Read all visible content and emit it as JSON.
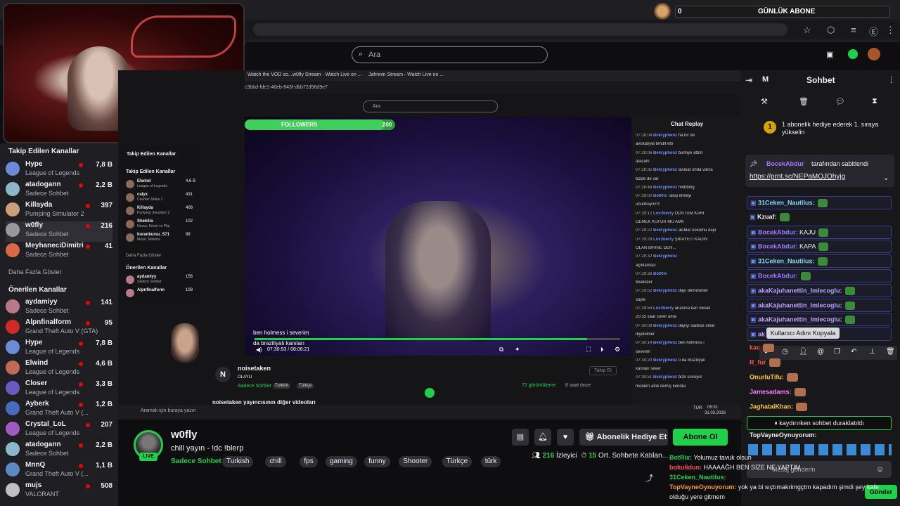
{
  "browser": {
    "tab_numbers": "3"
  },
  "goal": {
    "count": "0",
    "label": "GÜNLÜK ABONE"
  },
  "search": {
    "placeholder": "Ara"
  },
  "sidebar": {
    "followed_title": "Takip Edilen Kanallar",
    "followed": [
      {
        "name": "Hype",
        "game": "League of Legends",
        "count": "7,8 B",
        "color": "#6b8bd6"
      },
      {
        "name": "atadogann",
        "game": "Sadece Sohbet",
        "count": "2,2 B",
        "color": "#8ab8c8"
      },
      {
        "name": "Killayda",
        "game": "Pumping Simulator 2",
        "count": "397",
        "color": "#c9a07a"
      },
      {
        "name": "w0fly",
        "game": "Sadece Sohbet",
        "count": "216",
        "color": "#999999"
      },
      {
        "name": "MeyhaneciDimitri",
        "game": "Sadece Sohbet",
        "count": "41",
        "color": "#d86a4a"
      }
    ],
    "more": "Daha Fazla Göster",
    "recommended_title": "Önerilen Kanallar",
    "recommended": [
      {
        "name": "aydamiyy",
        "game": "Sadece Sohbet",
        "count": "141",
        "color": "#b87a8a"
      },
      {
        "name": "Alpnfinalform",
        "game": "Grand Theft Auto V (GTA)",
        "count": "95",
        "color": "#d12828"
      },
      {
        "name": "Hype",
        "game": "League of Legends",
        "count": "7,8 B",
        "color": "#6b8bd6"
      },
      {
        "name": "Elwind",
        "game": "League of Legends",
        "count": "4,6 B",
        "color": "#c06a5a"
      },
      {
        "name": "Closer",
        "game": "League of Legends",
        "count": "3,3 B",
        "color": "#6a5ac0"
      },
      {
        "name": "Ayberk",
        "game": "Grand Theft Auto V (...",
        "count": "1,2 B",
        "color": "#4a6ac0"
      },
      {
        "name": "Crystal_LoL",
        "game": "League of Legends",
        "count": "207",
        "color": "#a05ac0"
      },
      {
        "name": "atadogann",
        "game": "Sadece Sohbet",
        "count": "2,2 B",
        "color": "#8ab8c8"
      },
      {
        "name": "MnnQ",
        "game": "Grand Theft Auto V (...",
        "count": "1,1 B",
        "color": "#5a8ac0"
      },
      {
        "name": "mujs",
        "game": "VALORANT",
        "count": "508",
        "color": "#c0c0c0"
      }
    ]
  },
  "inner": {
    "tabs": [
      "Watch the VOD so...",
      "w0fly Stream - Watch Live on ...",
      "Jahnnin Stream - Watch Live on ..."
    ],
    "url": "c3bbd-fde1-46eb-843f-dbb72d56d9e7",
    "search": "Ara",
    "followers_label": "FOLLOWERS",
    "followers_count": "200",
    "followers_progress": 0.93,
    "side_title": "Takip Edilen Kanallar",
    "side_section": "Takip Edilen Kanallar",
    "side_items": [
      {
        "name": "Elwind",
        "game": "League of Legends",
        "count": "4,6 B"
      },
      {
        "name": "calyx",
        "game": "Counter-Strike 2",
        "count": "431"
      },
      {
        "name": "Killayda",
        "game": "Pumping Simulator 2",
        "count": "408"
      },
      {
        "name": "Shekilia",
        "game": "Havuz, Küvet ve Plaj",
        "count": "102"
      },
      {
        "name": "kurankursu_571",
        "game": "Music Stations",
        "count": "98"
      }
    ],
    "side_more": "Daha Fazla Göster",
    "side_rec": "Önerilen Kanallar",
    "side_rec_items": [
      {
        "name": "aydamiyy",
        "game": "Sadece Sohbet",
        "count": "156"
      },
      {
        "name": "Alpnfinalform",
        "game": "",
        "count": "108"
      }
    ],
    "caption1": "ben holmess i severim",
    "caption2": "da braziliyalı kanıları",
    "time": "07:30:53 / 08:06:21",
    "chat_title": "Chat Replay",
    "chat": [
      {
        "t": "07:28:04",
        "u": "Bekryphenz",
        "m": "ha bir de"
      },
      {
        "t": "",
        "u": "",
        "m": "avukatıyla tehdit etti"
      },
      {
        "t": "07:28:06",
        "u": "Bekryphenz",
        "m": "burhiye attım"
      },
      {
        "t": "",
        "u": "",
        "m": "atacam"
      },
      {
        "t": "07:28:35",
        "u": "Bekryphenz",
        "m": "avukat onda varsa"
      },
      {
        "t": "",
        "u": "",
        "m": "bizde de var"
      },
      {
        "t": "07:28:46",
        "u": "Bekryphenz",
        "m": "mobbing"
      },
      {
        "t": "07:29:00",
        "u": "BotRix",
        "m": "Takip etmeyi"
      },
      {
        "t": "",
        "u": "",
        "m": "unutmayın!!!!"
      },
      {
        "t": "07:29:12",
        "u": "Lov3berry",
        "m": "DOSTUM KARI"
      },
      {
        "t": "",
        "u": "",
        "m": "DEMEK KÜFÜR MÜ AMK"
      },
      {
        "t": "07:29:22",
        "u": "Bekryphenz",
        "m": "akıldar kokumu dayı"
      },
      {
        "t": "07:29:28",
        "u": "Lov3berry",
        "m": "ŞİKAYETİ KADIN"
      },
      {
        "t": "",
        "u": "",
        "m": "OLAN BİRİNE DEN..."
      },
      {
        "t": "07:29:32",
        "u": "Bekryphenz",
        "m": ""
      },
      {
        "t": "",
        "u": "",
        "m": "açıklaması"
      },
      {
        "t": "07:29:36",
        "u": "BotRix",
        "m": ""
      },
      {
        "t": "",
        "u": "",
        "m": "biseksler"
      },
      {
        "t": "07:29:52",
        "u": "Bekryphenz",
        "m": "dayı demesinler"
      },
      {
        "t": "",
        "u": "",
        "m": "söyle"
      },
      {
        "t": "07:29:54",
        "u": "Lov3berry",
        "m": "anasına karı desek"
      },
      {
        "t": "",
        "u": "",
        "m": "20:35 saat söver ama"
      },
      {
        "t": "07:30:08",
        "u": "Bekryphenz",
        "m": "dayıyı sadece onlar"
      },
      {
        "t": "",
        "u": "",
        "m": "diyebilirler"
      },
      {
        "t": "07:30:14",
        "u": "Bekryphenz",
        "m": "ben holmess i"
      },
      {
        "t": "",
        "u": "",
        "m": "severim"
      },
      {
        "t": "07:30:20",
        "u": "Bekryphenz",
        "m": "o da braziliyalı"
      },
      {
        "t": "",
        "u": "",
        "m": "kanıları sever"
      },
      {
        "t": "07:30:51",
        "u": "Bekryphenz",
        "m": "bize sövüyor"
      },
      {
        "t": "",
        "u": "",
        "m": "modern amk demiş kendisi"
      }
    ],
    "channel": "noisetaken",
    "channel_cat": "OLAYLI",
    "cat2": "Sadece Sohbet",
    "tag1": "Turkish",
    "tag2": "Türkçe",
    "follow": "Takip Et",
    "views": "72 görüntüleme",
    "ago": "8 saat önce",
    "more_videos": "noisetaken yayıncısının diğer videoları",
    "taskbar_search": "Aramak için buraya yazın",
    "clock": "05:31",
    "date": "31.03.2026",
    "lang": "TUR"
  },
  "stream": {
    "name": "w0fly",
    "title": "chill yayın - !dc !blerp",
    "category": "Sadece Sohbet",
    "tags": [
      "Turkish",
      "chill",
      "fps",
      "gaming",
      "funny",
      "Shooter",
      "Türkçe",
      "türk"
    ],
    "live": "LIVE",
    "gift_label": "Abonelik Hediye Et",
    "sub_label": "Abone Ol",
    "viewers": "216",
    "viewers_label": "İzleyici",
    "chatters": "15",
    "chatters_label": "Ort. Sohbete Katılan..."
  },
  "chat": {
    "header_letter": "M",
    "title": "Sohbet",
    "banner": "1 abonelik hediye ederek 1. sıraya yükselin",
    "banner_num": "1",
    "pinned_by": "BocekAbdur",
    "pinned_suffix": "tarafından sabitlendi",
    "pinned_link": "https://prnt.sc/NEPaMOJOhyjg",
    "messages": [
      {
        "user": "31Ceken_Nautilus:",
        "msg": "",
        "color": "#7fd7ff",
        "boxed": true
      },
      {
        "user": "Kzuaf:",
        "msg": "",
        "color": "#efeff1",
        "boxed": false
      },
      {
        "user": "BocekAbdur:",
        "msg": " KAJU",
        "color": "#9b7bff",
        "boxed": true
      },
      {
        "user": "BocekAbdur:",
        "msg": " KAPA",
        "color": "#9b7bff",
        "boxed": true
      },
      {
        "user": "31Ceken_Nautilus:",
        "msg": "",
        "color": "#7fd7ff",
        "boxed": true
      },
      {
        "user": "BocekAbdur:",
        "msg": "",
        "color": "#9b7bff",
        "boxed": true
      },
      {
        "user": "akaKajuhanettin_Imlecoglu:",
        "msg": "",
        "color": "#b8a0ff",
        "boxed": true
      },
      {
        "user": "akaKajuhanettin_Imlecoglu:",
        "msg": "",
        "color": "#b8a0ff",
        "boxed": true
      },
      {
        "user": "akaKajuhanettin_Imlecoglu:",
        "msg": "",
        "color": "#b8a0ff",
        "boxed": true
      },
      {
        "user": "ak",
        "msg": "",
        "color": "#b8a0ff",
        "boxed": true
      }
    ],
    "tooltip": "Kullanıcı Adını Kopyala",
    "lower": [
      {
        "user": "kac",
        "msg": "",
        "color": "#ff5050"
      },
      {
        "user": "R_fur",
        "msg": "",
        "color": "#ff5050"
      },
      {
        "user": "OnurluTifu:",
        "msg": "",
        "color": "#ffcc33"
      },
      {
        "user": "Jamesadams:",
        "msg": "",
        "color": "#ff7fff"
      },
      {
        "user": "JaghataiKhan:",
        "msg": "",
        "color": "#ffcc33"
      }
    ],
    "r_fur2": "R_fur",
    "paused": "kaydırırken sohbet duraklatıldı",
    "topvayne": "TopVayneOynuyorum:",
    "input_placeholder": "Mesaj gönderin",
    "send": "Gönder",
    "overlay": [
      {
        "user": "BotRix:",
        "msg": "Yolumuz tavuk olsun",
        "color": "#1fd14a"
      },
      {
        "user": "bokulidun:",
        "msg": "HAAAAĞH BEN SİZE NE YAPTIM",
        "color": "#ff5050"
      },
      {
        "user": "31Ceken_Nautilus:",
        "msg": "",
        "color": "#1fd14a"
      },
      {
        "user": "TopVayneOynuyorum:",
        "msg": "yok ya bi sıçtımakrimgçtm kapadım şimdi şey kafe",
        "color": "#ff9a33"
      },
      {
        "user": "",
        "msg": "olduğu yere gitmem",
        "color": "#efeff1"
      }
    ]
  },
  "colors": {
    "accent": "#1fd14a",
    "live": "#eb0400",
    "bg": "#0e0e10"
  }
}
